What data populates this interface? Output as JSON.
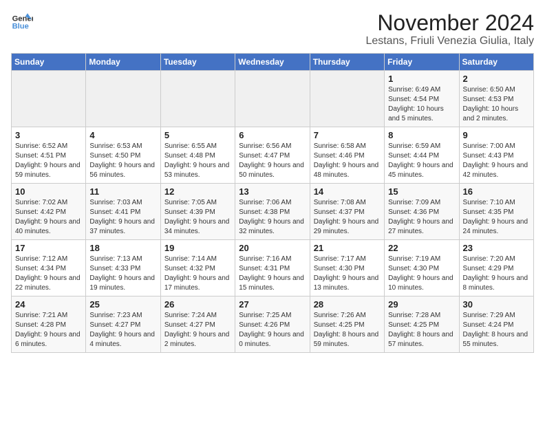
{
  "logo": {
    "line1": "General",
    "line2": "Blue"
  },
  "title": "November 2024",
  "location": "Lestans, Friuli Venezia Giulia, Italy",
  "daylight_label": "Daylight hours",
  "headers": [
    "Sunday",
    "Monday",
    "Tuesday",
    "Wednesday",
    "Thursday",
    "Friday",
    "Saturday"
  ],
  "weeks": [
    [
      {
        "day": "",
        "info": ""
      },
      {
        "day": "",
        "info": ""
      },
      {
        "day": "",
        "info": ""
      },
      {
        "day": "",
        "info": ""
      },
      {
        "day": "",
        "info": ""
      },
      {
        "day": "1",
        "info": "Sunrise: 6:49 AM\nSunset: 4:54 PM\nDaylight: 10 hours and 5 minutes."
      },
      {
        "day": "2",
        "info": "Sunrise: 6:50 AM\nSunset: 4:53 PM\nDaylight: 10 hours and 2 minutes."
      }
    ],
    [
      {
        "day": "3",
        "info": "Sunrise: 6:52 AM\nSunset: 4:51 PM\nDaylight: 9 hours and 59 minutes."
      },
      {
        "day": "4",
        "info": "Sunrise: 6:53 AM\nSunset: 4:50 PM\nDaylight: 9 hours and 56 minutes."
      },
      {
        "day": "5",
        "info": "Sunrise: 6:55 AM\nSunset: 4:48 PM\nDaylight: 9 hours and 53 minutes."
      },
      {
        "day": "6",
        "info": "Sunrise: 6:56 AM\nSunset: 4:47 PM\nDaylight: 9 hours and 50 minutes."
      },
      {
        "day": "7",
        "info": "Sunrise: 6:58 AM\nSunset: 4:46 PM\nDaylight: 9 hours and 48 minutes."
      },
      {
        "day": "8",
        "info": "Sunrise: 6:59 AM\nSunset: 4:44 PM\nDaylight: 9 hours and 45 minutes."
      },
      {
        "day": "9",
        "info": "Sunrise: 7:00 AM\nSunset: 4:43 PM\nDaylight: 9 hours and 42 minutes."
      }
    ],
    [
      {
        "day": "10",
        "info": "Sunrise: 7:02 AM\nSunset: 4:42 PM\nDaylight: 9 hours and 40 minutes."
      },
      {
        "day": "11",
        "info": "Sunrise: 7:03 AM\nSunset: 4:41 PM\nDaylight: 9 hours and 37 minutes."
      },
      {
        "day": "12",
        "info": "Sunrise: 7:05 AM\nSunset: 4:39 PM\nDaylight: 9 hours and 34 minutes."
      },
      {
        "day": "13",
        "info": "Sunrise: 7:06 AM\nSunset: 4:38 PM\nDaylight: 9 hours and 32 minutes."
      },
      {
        "day": "14",
        "info": "Sunrise: 7:08 AM\nSunset: 4:37 PM\nDaylight: 9 hours and 29 minutes."
      },
      {
        "day": "15",
        "info": "Sunrise: 7:09 AM\nSunset: 4:36 PM\nDaylight: 9 hours and 27 minutes."
      },
      {
        "day": "16",
        "info": "Sunrise: 7:10 AM\nSunset: 4:35 PM\nDaylight: 9 hours and 24 minutes."
      }
    ],
    [
      {
        "day": "17",
        "info": "Sunrise: 7:12 AM\nSunset: 4:34 PM\nDaylight: 9 hours and 22 minutes."
      },
      {
        "day": "18",
        "info": "Sunrise: 7:13 AM\nSunset: 4:33 PM\nDaylight: 9 hours and 19 minutes."
      },
      {
        "day": "19",
        "info": "Sunrise: 7:14 AM\nSunset: 4:32 PM\nDaylight: 9 hours and 17 minutes."
      },
      {
        "day": "20",
        "info": "Sunrise: 7:16 AM\nSunset: 4:31 PM\nDaylight: 9 hours and 15 minutes."
      },
      {
        "day": "21",
        "info": "Sunrise: 7:17 AM\nSunset: 4:30 PM\nDaylight: 9 hours and 13 minutes."
      },
      {
        "day": "22",
        "info": "Sunrise: 7:19 AM\nSunset: 4:30 PM\nDaylight: 9 hours and 10 minutes."
      },
      {
        "day": "23",
        "info": "Sunrise: 7:20 AM\nSunset: 4:29 PM\nDaylight: 9 hours and 8 minutes."
      }
    ],
    [
      {
        "day": "24",
        "info": "Sunrise: 7:21 AM\nSunset: 4:28 PM\nDaylight: 9 hours and 6 minutes."
      },
      {
        "day": "25",
        "info": "Sunrise: 7:23 AM\nSunset: 4:27 PM\nDaylight: 9 hours and 4 minutes."
      },
      {
        "day": "26",
        "info": "Sunrise: 7:24 AM\nSunset: 4:27 PM\nDaylight: 9 hours and 2 minutes."
      },
      {
        "day": "27",
        "info": "Sunrise: 7:25 AM\nSunset: 4:26 PM\nDaylight: 9 hours and 0 minutes."
      },
      {
        "day": "28",
        "info": "Sunrise: 7:26 AM\nSunset: 4:25 PM\nDaylight: 8 hours and 59 minutes."
      },
      {
        "day": "29",
        "info": "Sunrise: 7:28 AM\nSunset: 4:25 PM\nDaylight: 8 hours and 57 minutes."
      },
      {
        "day": "30",
        "info": "Sunrise: 7:29 AM\nSunset: 4:24 PM\nDaylight: 8 hours and 55 minutes."
      }
    ]
  ]
}
